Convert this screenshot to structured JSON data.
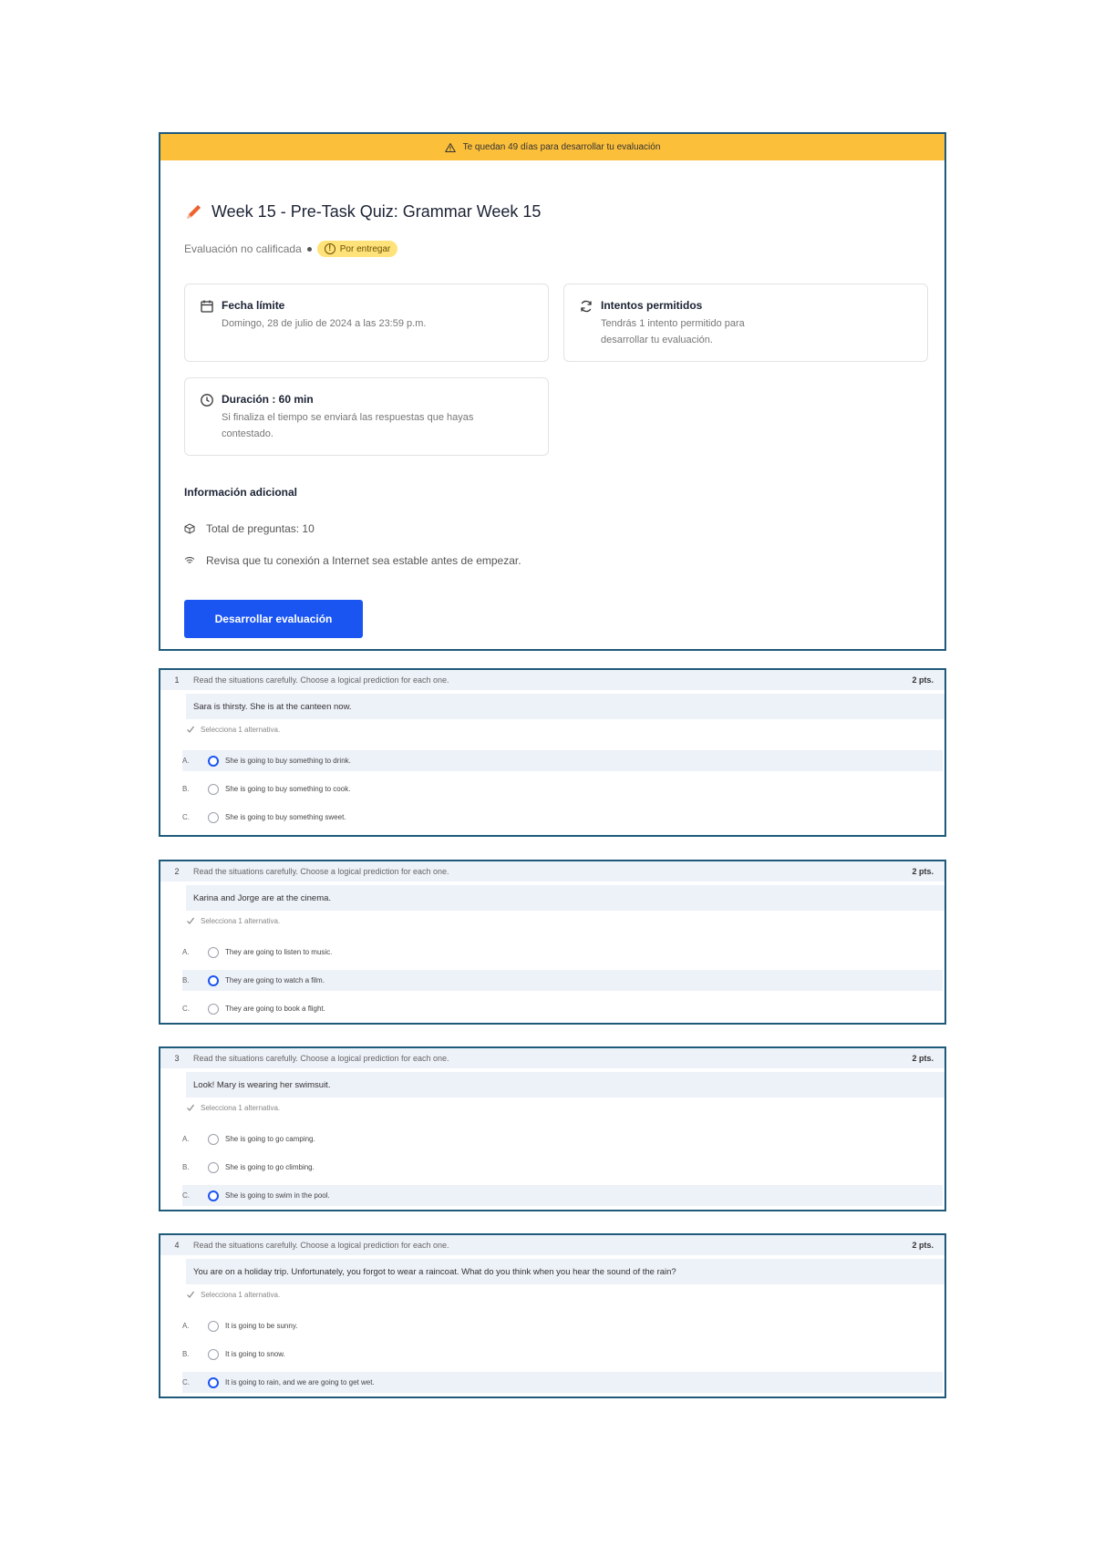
{
  "banner": {
    "text": "Te quedan 49 días para desarrollar tu evaluación",
    "icon": "warning-icon",
    "color": "#fcbf3a"
  },
  "quiz": {
    "title": "Week 15 - Pre-Task Quiz: Grammar Week 15",
    "type_label": "Evaluación no calificada",
    "status_badge": "Por entregar"
  },
  "cards": {
    "deadline": {
      "title": "Fecha límite",
      "desc": "Domingo, 28 de julio de 2024 a las 23:59 p.m."
    },
    "attempts": {
      "title": "Intentos permitidos",
      "desc": "Tendrás 1 intento permitido para desarrollar tu evaluación."
    },
    "duration": {
      "title": "Duración : 60 min",
      "desc": "Si finaliza el tiempo se enviará las respuestas que hayas contestado."
    }
  },
  "additional": {
    "title": "Información adicional",
    "questions": "Total de preguntas: 10",
    "connection": "Revisa que tu conexión a Internet sea estable antes de empezar."
  },
  "start_button": "Desarrollar evaluación",
  "accent_color": "#1a55f2",
  "questions": [
    {
      "num": "1",
      "instruction": "Read the situations carefully. Choose a logical prediction for each one.",
      "points": "2 pts.",
      "prompt": "Sara is thirsty. She is at the canteen now.",
      "hint": "Selecciona 1 alternativa.",
      "options": [
        {
          "letter": "A.",
          "text": "She is going to buy something to drink.",
          "selected": true
        },
        {
          "letter": "B.",
          "text": "She is going to buy something to cook.",
          "selected": false
        },
        {
          "letter": "C.",
          "text": "She is going to buy something sweet.",
          "selected": false
        }
      ]
    },
    {
      "num": "2",
      "instruction": "Read the situations carefully. Choose a logical prediction for each one.",
      "points": "2 pts.",
      "prompt": "Karina and Jorge are at the cinema.",
      "hint": "Selecciona 1 alternativa.",
      "options": [
        {
          "letter": "A.",
          "text": "They are going to listen to music.",
          "selected": false
        },
        {
          "letter": "B.",
          "text": "They are going to watch a film.",
          "selected": true
        },
        {
          "letter": "C.",
          "text": "They are going to book a flight.",
          "selected": false
        }
      ]
    },
    {
      "num": "3",
      "instruction": "Read the situations carefully. Choose a logical prediction for each one.",
      "points": "2 pts.",
      "prompt": "Look! Mary is wearing her swimsuit.",
      "hint": "Selecciona 1 alternativa.",
      "options": [
        {
          "letter": "A.",
          "text": "She is going to go camping.",
          "selected": false
        },
        {
          "letter": "B.",
          "text": "She is going to go climbing.",
          "selected": false
        },
        {
          "letter": "C.",
          "text": "She is going to swim in the pool.",
          "selected": true
        }
      ]
    },
    {
      "num": "4",
      "instruction": "Read the situations carefully. Choose a logical prediction for each one.",
      "points": "2 pts.",
      "prompt": "You are on a holiday trip. Unfortunately, you forgot to wear a raincoat. What do you think when you hear the sound of the rain?",
      "hint": "Selecciona 1 alternativa.",
      "options": [
        {
          "letter": "A.",
          "text": "It is going to be sunny.",
          "selected": false
        },
        {
          "letter": "B.",
          "text": "It is going to snow.",
          "selected": false
        },
        {
          "letter": "C.",
          "text": "It is going to rain, and we are going to get wet.",
          "selected": true
        }
      ]
    }
  ]
}
